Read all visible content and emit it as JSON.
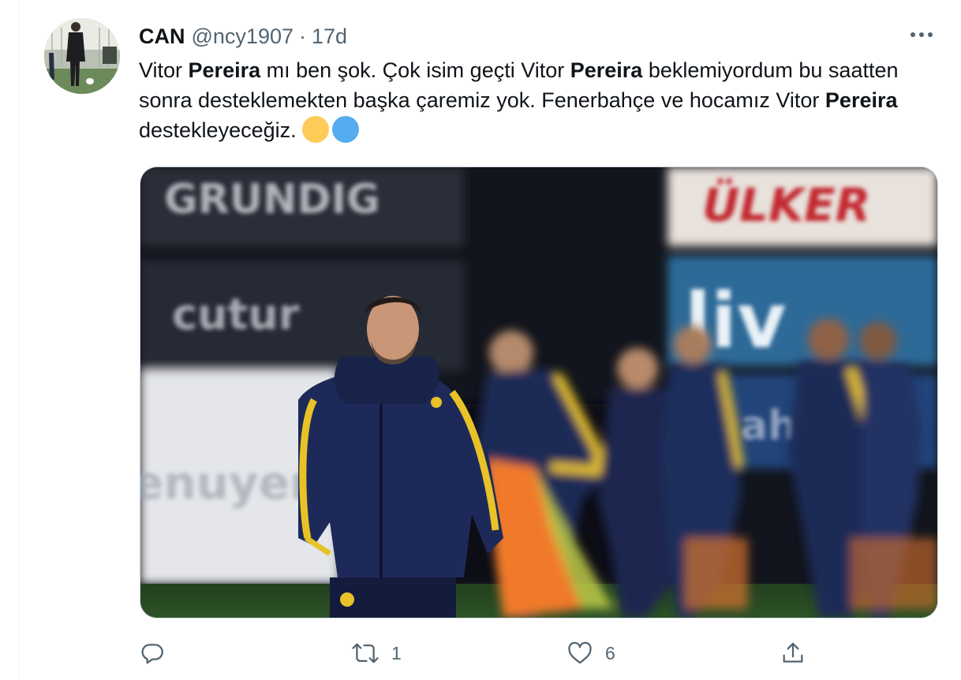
{
  "tweet": {
    "author_name": "CAN",
    "handle": "@ncy1907",
    "separator": "·",
    "time": "17d",
    "text_parts": [
      {
        "text": "Vitor ",
        "bold": false
      },
      {
        "text": "Pereira",
        "bold": true
      },
      {
        "text": " mı ben şok. Çok isim geçti Vitor ",
        "bold": false
      },
      {
        "text": "Pereira",
        "bold": true
      },
      {
        "text": "  beklemiyordum bu saatten sonra desteklemekten başka çaremiz yok. Fenerbahçe ve hocamız  Vitor ",
        "bold": false
      },
      {
        "text": "Pereira",
        "bold": true
      },
      {
        "text": " destekleyeceğiz. ",
        "bold": false
      }
    ],
    "emojis": [
      {
        "name": "yellow-circle-emoji",
        "color": "#fdcb58"
      },
      {
        "name": "blue-circle-emoji",
        "color": "#55acee"
      }
    ],
    "media": {
      "banners": [
        "GRUNDIG",
        "ÜLKER",
        "liv",
        "cutur",
        "enuyer",
        "ahj"
      ]
    }
  },
  "actions": {
    "reply": {
      "icon": "reply-icon",
      "count": ""
    },
    "retweet": {
      "icon": "retweet-icon",
      "count": "1"
    },
    "like": {
      "icon": "heart-icon",
      "count": "6"
    },
    "share": {
      "icon": "share-icon",
      "count": ""
    }
  },
  "colors": {
    "text": "#0f1419",
    "secondary": "#536471",
    "border": "#cfd9de",
    "kit_navy": "#1d2b57",
    "kit_yellow": "#e8c227"
  }
}
